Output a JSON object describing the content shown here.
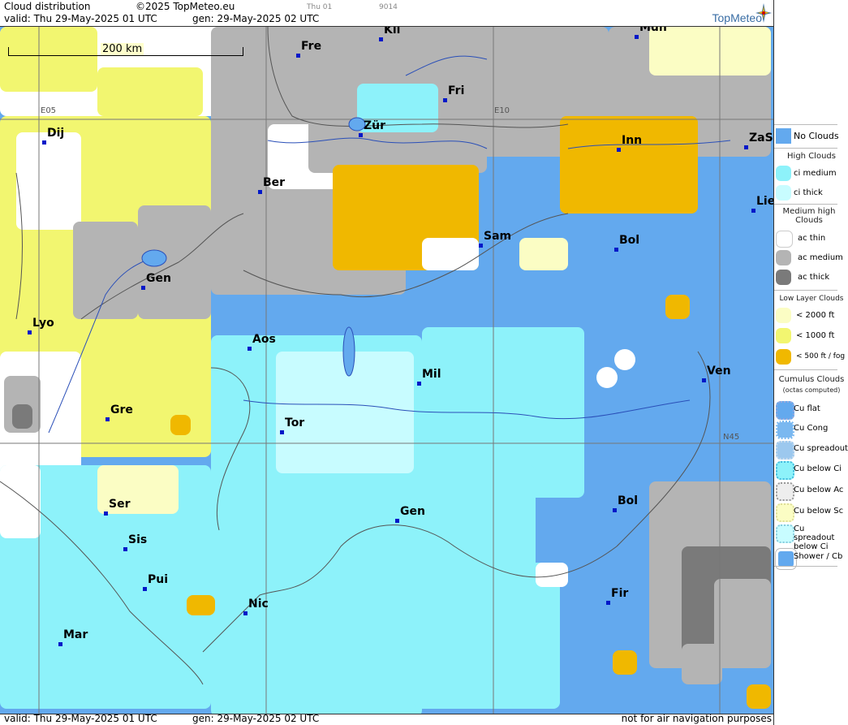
{
  "header": {
    "title": "Cloud distribution",
    "copyright": "©2025 TopMeteo.eu",
    "small1": "Thu 01",
    "small2": "9014",
    "valid": "valid:  Thu  29-May-2025  01 UTC",
    "gen": "gen: 29-May-2025 02 UTC",
    "brand": "TopMeteo"
  },
  "map": {
    "scale_label": "200 km",
    "grid_labels": [
      "E05",
      "E10",
      "N45"
    ],
    "cities": [
      {
        "name": "Fre"
      },
      {
        "name": "Kli"
      },
      {
        "name": "Mün"
      },
      {
        "name": "Fri"
      },
      {
        "name": "Dij"
      },
      {
        "name": "Zür"
      },
      {
        "name": "Inn"
      },
      {
        "name": "ZaS"
      },
      {
        "name": "Ber"
      },
      {
        "name": "Lie"
      },
      {
        "name": "Sam"
      },
      {
        "name": "Bol"
      },
      {
        "name": "Gen"
      },
      {
        "name": "Lyo"
      },
      {
        "name": "Aos"
      },
      {
        "name": "Mil"
      },
      {
        "name": "Ven"
      },
      {
        "name": "Gre"
      },
      {
        "name": "Tor"
      },
      {
        "name": "Ser"
      },
      {
        "name": "Gen"
      },
      {
        "name": "Bol"
      },
      {
        "name": "Sis"
      },
      {
        "name": "Pui"
      },
      {
        "name": "Nic"
      },
      {
        "name": "Fir"
      },
      {
        "name": "Mar"
      }
    ]
  },
  "footer": {
    "valid": "valid:  Thu  29-May-2025  01 UTC",
    "gen": "gen: 29-May-2025 02 UTC",
    "note": "not for air navigation purposes"
  },
  "legend": {
    "no_clouds": "No Clouds",
    "high_title": "High Clouds",
    "high_items": [
      "ci medium",
      "ci thick"
    ],
    "medium_title": "Medium high Clouds",
    "medium_items": [
      "ac thin",
      "ac medium",
      "ac thick"
    ],
    "low_title": "Low Layer Clouds",
    "low_items": [
      "< 2000 ft",
      "< 1000 ft",
      "< 500 ft / fog"
    ],
    "cumulus_title": "Cumulus Clouds",
    "cumulus_sub": "(octas computed)",
    "cumulus_items": [
      "Cu flat",
      "Cu Cong",
      "Cu spreadout",
      "Cu below Ci",
      "Cu below Ac",
      "Cu below Sc",
      "Cu spreadout below Ci",
      "Shower / Cb"
    ]
  },
  "colors": {
    "no_clouds": "#63a9ee",
    "ci_medium": "#8df2fa",
    "ci_thick": "#c8fcff",
    "ac_thin": "#ffffff",
    "ac_medium": "#b4b4b4",
    "ac_thick": "#7a7a7a",
    "low_2000": "#fbfdc4",
    "low_1000": "#f2f670",
    "low_500": "#f0b800"
  }
}
